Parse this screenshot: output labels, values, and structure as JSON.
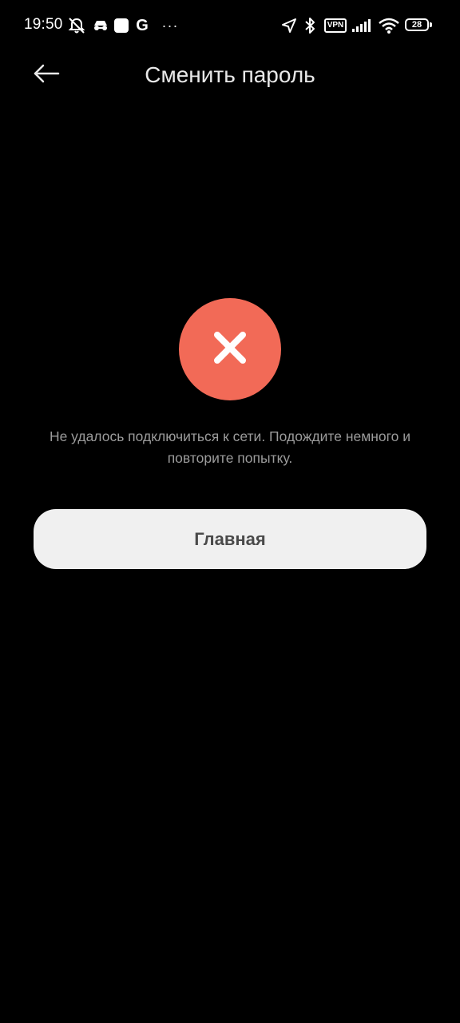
{
  "status_bar": {
    "time": "19:50",
    "google_letter": "G",
    "more": "···",
    "vpn": "VPN",
    "battery": "28",
    "icons": [
      "muted-alarm-icon",
      "incognito-icon",
      "app-square-icon",
      "google-icon",
      "more-dots-icon",
      "location-arrow-icon",
      "bluetooth-icon",
      "vpn-icon",
      "signal-icon",
      "wifi-icon",
      "battery-icon"
    ]
  },
  "header": {
    "back_icon": "arrow-left-icon",
    "title": "Сменить пароль"
  },
  "error": {
    "icon": "close-icon",
    "icon_color": "#f26a57",
    "message": "Не удалось подключиться к сети. Подождите немного и повторите попытку."
  },
  "actions": {
    "home_label": "Главная"
  }
}
